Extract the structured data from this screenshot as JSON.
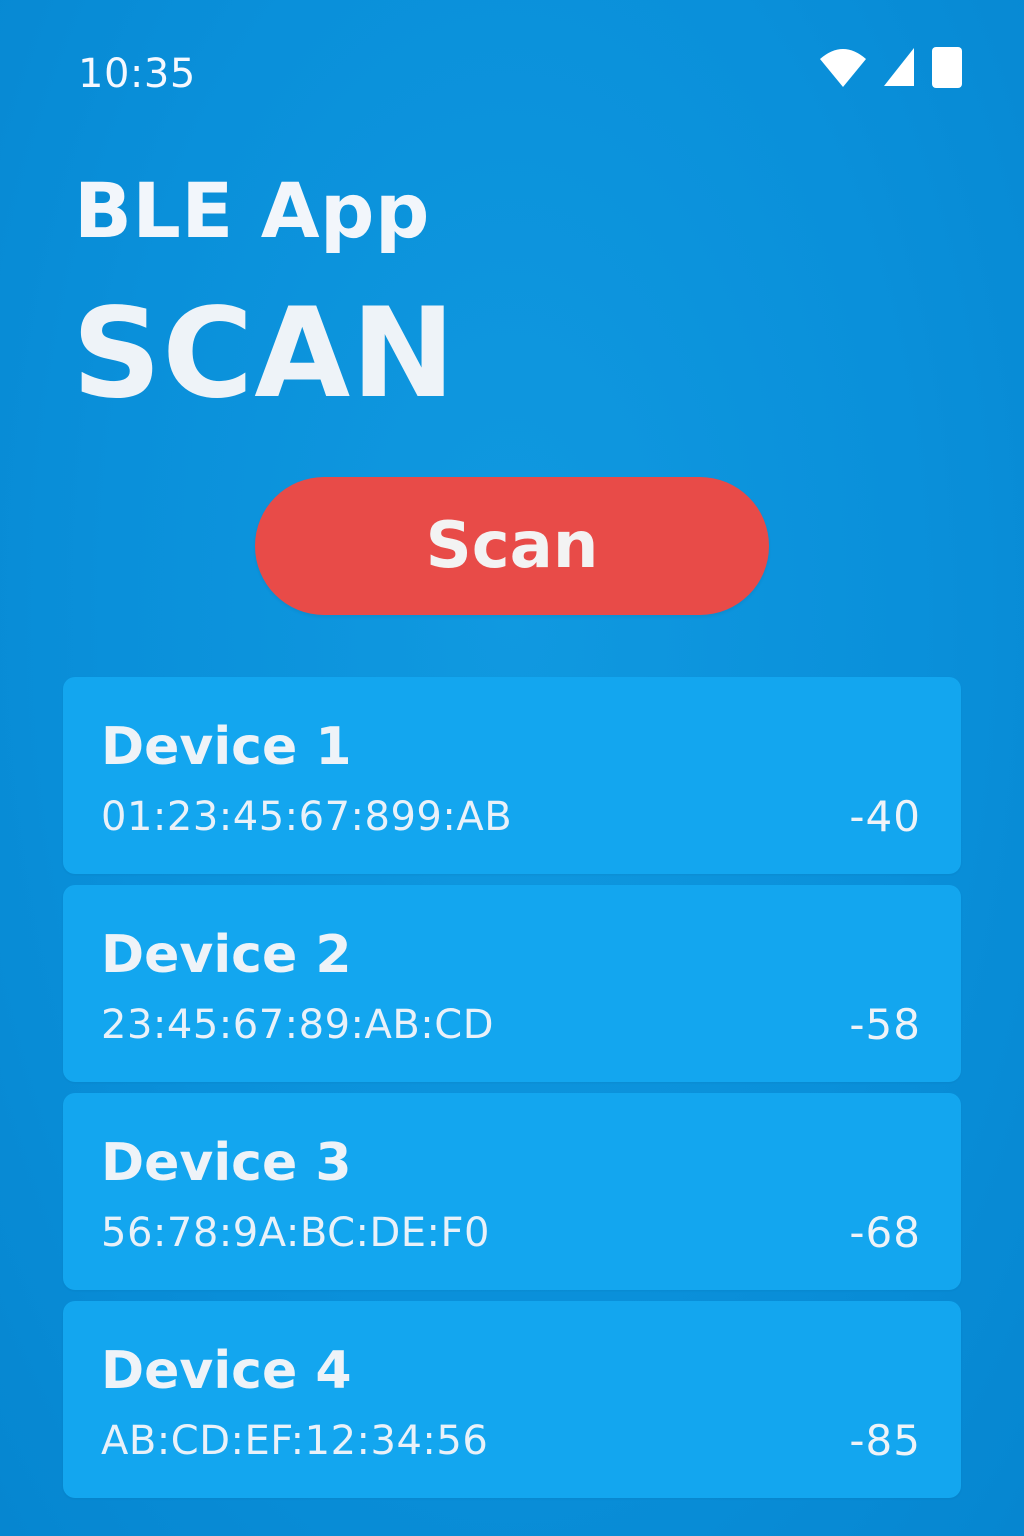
{
  "status_bar": {
    "time": "10:35",
    "icons": [
      "wifi-icon",
      "cellular-signal-icon",
      "battery-icon"
    ]
  },
  "header": {
    "app_title": "BLE App",
    "screen_title": "SCAN"
  },
  "scan_button": {
    "label": "Scan",
    "color": "#e84b48"
  },
  "devices": [
    {
      "name": "Device 1",
      "address": "01:23:45:67:899:AB",
      "rssi": "-40"
    },
    {
      "name": "Device 2",
      "address": "23:45:67:89:AB:CD",
      "rssi": "-58"
    },
    {
      "name": "Device 3",
      "address": "56:78:9A:BC:DE:F0",
      "rssi": "-68"
    },
    {
      "name": "Device 4",
      "address": "AB:CD:EF:12:34:56",
      "rssi": "-85"
    }
  ],
  "colors": {
    "background": "#0890d9",
    "card": "#13a6ef",
    "text": "#ffffff"
  }
}
